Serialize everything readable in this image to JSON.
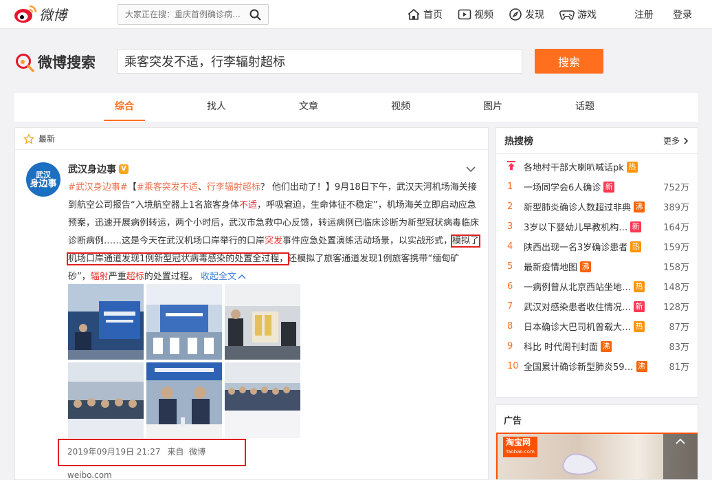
{
  "topbar": {
    "logo_text": "微博",
    "search_placeholder": "大家正在搜：重庆首例确诊病…",
    "nav": [
      "首页",
      "视频",
      "发现",
      "游戏"
    ],
    "register": "注册",
    "login": "登录"
  },
  "search": {
    "logo_text": "微博搜索",
    "query": "乘客突发不适，行李辐射超标",
    "button": "搜索"
  },
  "tabs": [
    "综合",
    "找人",
    "文章",
    "视频",
    "图片",
    "话题"
  ],
  "feed": {
    "section_label": "最新",
    "post": {
      "author": "武汉身边事",
      "avatar_line1": "武汉",
      "avatar_line2": "身边事",
      "verified_badge": "V",
      "text": {
        "p1": "#武汉身边事#",
        "p2": "【",
        "p3": "#乘客突发不适",
        "p4": "、",
        "p5": "行李辐射超标",
        "p6": "？ 他们出动了！】9月18日下午，武汉天河机场海关接到航空公司报告“入境航空器上1名旅客身体",
        "p7": "不适",
        "p8": "，呼吸窘迫，生命体征不稳定”，机场海关立即启动应急预案，迅速开展病例转运，两个小时后，武汉市急救中心反馈，转运病例已临床诊断为新型冠状病毒临床诊断病例……这是今天在武汉机场口岸举行的口岸",
        "p9": "突发",
        "p10": "事件应急处置演练活动场景，以实战形式，",
        "boxed": "模拟了机场口岸通道发现1例新型冠状病毒感染的处置全过程，",
        "p11": "还模拟了旅客通道发现1例旅客携带“缅甸矿砂”，",
        "p12": "辐射",
        "p13": "严重",
        "p14": "超标",
        "p15": "的处置过程。 ",
        "collapse": "收起全文"
      },
      "photos": [
        "",
        "",
        "",
        "",
        "",
        ""
      ],
      "meta": {
        "time": "2019年09月19日 21:27",
        "from_label": "来自",
        "source": "微博 weibo.com"
      }
    }
  },
  "hot": {
    "title": "热搜榜",
    "more": "更多",
    "items": [
      {
        "rank": "",
        "text": "各地村干部大喇叭喊话pk",
        "tag": "热",
        "tag_type": "hot",
        "count": ""
      },
      {
        "rank": "1",
        "text": "一场同学会6人确诊",
        "tag": "新",
        "tag_type": "new",
        "count": "752万"
      },
      {
        "rank": "2",
        "text": "新型肺炎确诊人数超过非典",
        "tag": "沸",
        "tag_type": "fei",
        "count": "389万"
      },
      {
        "rank": "3",
        "text": "3岁以下婴幼儿早教机构…",
        "tag": "新",
        "tag_type": "new",
        "count": "164万"
      },
      {
        "rank": "4",
        "text": "陕西出现一名3岁确诊患者",
        "tag": "热",
        "tag_type": "hot",
        "count": "159万"
      },
      {
        "rank": "5",
        "text": "最新疫情地图",
        "tag": "沸",
        "tag_type": "fei",
        "count": "158万"
      },
      {
        "rank": "6",
        "text": "一病例曾从北京西站坐地…",
        "tag": "热",
        "tag_type": "hot",
        "count": "148万"
      },
      {
        "rank": "7",
        "text": "武汉对感染患者收住情况…",
        "tag": "新",
        "tag_type": "new",
        "count": "128万"
      },
      {
        "rank": "8",
        "text": "日本确诊大巴司机曾载大…",
        "tag": "热",
        "tag_type": "hot",
        "count": "87万"
      },
      {
        "rank": "9",
        "text": "科比 时代周刊封面",
        "tag": "沸",
        "tag_type": "fei",
        "count": "83万"
      },
      {
        "rank": "10",
        "text": "全国累计确诊新型肺炎59…",
        "tag": "沸",
        "tag_type": "fei",
        "count": "81万"
      }
    ]
  },
  "ad": {
    "title": "广告",
    "brand": "淘宝网",
    "brand_sub": "Taobao.com"
  },
  "colors": {
    "accent": "#ff6f1d",
    "link": "#eb7350",
    "highlight_box": "#e02020"
  }
}
